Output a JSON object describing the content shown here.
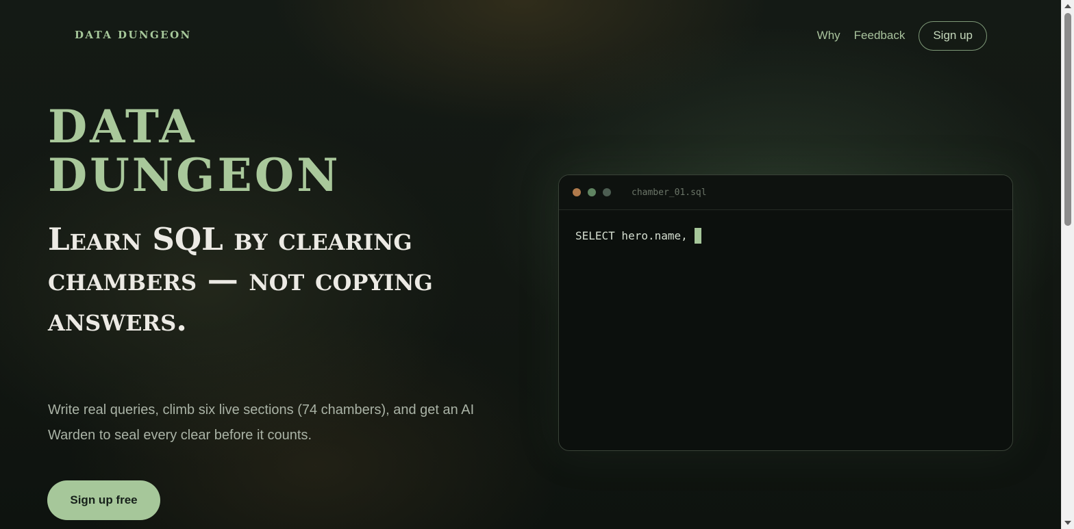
{
  "header": {
    "brand": "DATA DUNGEON",
    "nav": {
      "why": "Why",
      "feedback": "Feedback",
      "signup": "Sign up"
    }
  },
  "hero": {
    "title_line1": "DATA",
    "title_line2": "DUNGEON",
    "subtitle": "Learn SQL by clearing chambers — not copying answers.",
    "description": "Write real queries, climb six live sections (74 chambers), and get an AI Warden to seal every clear before it counts.",
    "cta": "Sign up free"
  },
  "editor": {
    "filename": "chamber_01.sql",
    "code": "SELECT hero.name,"
  },
  "colors": {
    "accent": "#a6c79a",
    "background": "#121712",
    "dot_1": "#b07a4c",
    "dot_2": "#5f8461",
    "dot_3": "#4d5e52"
  }
}
